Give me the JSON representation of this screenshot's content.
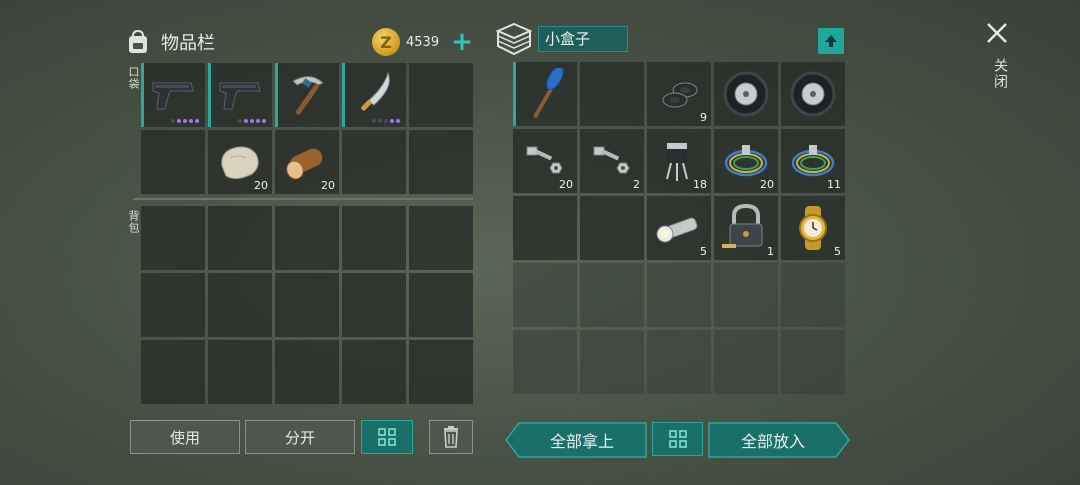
{
  "inventory": {
    "title": "物品栏",
    "coins": "4539",
    "pocket_label": "口袋",
    "backpack_label": "背包",
    "pocket_row1": [
      {
        "icon": "pistol-icon",
        "qty": "",
        "dots": 4
      },
      {
        "icon": "pistol-icon",
        "qty": "",
        "dots": 4
      },
      {
        "icon": "pickaxe-icon",
        "qty": ""
      },
      {
        "icon": "machete-icon",
        "qty": "",
        "dots": 2
      },
      {
        "icon": "",
        "qty": ""
      }
    ],
    "pocket_row2": [
      {
        "icon": "",
        "qty": ""
      },
      {
        "icon": "stone-icon",
        "qty": "20"
      },
      {
        "icon": "log-icon",
        "qty": "20"
      },
      {
        "icon": "",
        "qty": ""
      },
      {
        "icon": "",
        "qty": ""
      }
    ]
  },
  "container": {
    "name": "小盒子",
    "items": [
      {
        "icon": "paddle-icon",
        "qty": ""
      },
      {
        "icon": "",
        "qty": ""
      },
      {
        "icon": "gaskets-icon",
        "qty": "9"
      },
      {
        "icon": "tire-icon",
        "qty": ""
      },
      {
        "icon": "tire-icon",
        "qty": ""
      },
      {
        "icon": "bolt-icon",
        "qty": "20"
      },
      {
        "icon": "bolt-icon",
        "qty": "2"
      },
      {
        "icon": "transistor-icon",
        "qty": "18"
      },
      {
        "icon": "wire-icon",
        "qty": "20"
      },
      {
        "icon": "wire-icon",
        "qty": "11"
      },
      {
        "icon": "",
        "qty": ""
      },
      {
        "icon": "",
        "qty": ""
      },
      {
        "icon": "flashlight-icon",
        "qty": "5"
      },
      {
        "icon": "padlock-icon",
        "qty": "1"
      },
      {
        "icon": "watch-icon",
        "qty": "5"
      }
    ]
  },
  "close_label": "关闭",
  "buttons": {
    "use": "使用",
    "split": "分开",
    "take_all": "全部拿上",
    "put_all": "全部放入"
  },
  "colors": {
    "accent": "#1b6f69",
    "accent_light": "#2fa89b",
    "rarity_purple": "#a173e8"
  }
}
